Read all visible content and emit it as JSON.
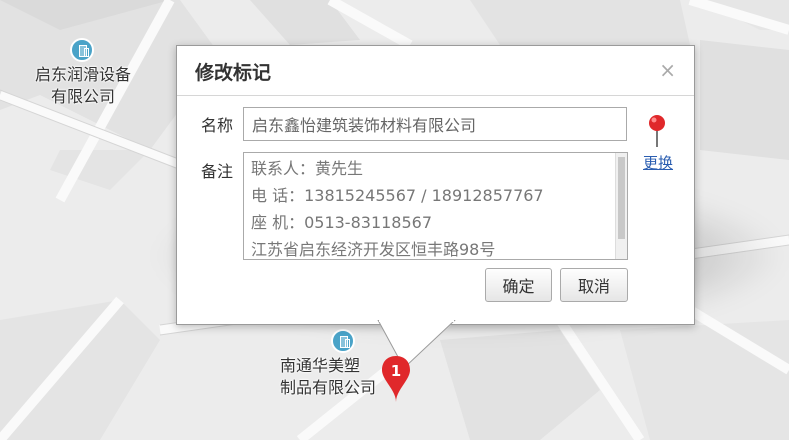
{
  "map": {
    "poi_top": {
      "line1": "启东润滑设备",
      "line2": "有限公司"
    },
    "poi_bottom": {
      "line1": "南通华美塑",
      "line2": "制品有限公司"
    },
    "marker_number": "1"
  },
  "dialog": {
    "title": "修改标记",
    "close_glyph": "×",
    "name_label": "名称",
    "name_value": "启东鑫怡建筑装饰材料有限公司",
    "note_label": "备注",
    "note_lines": [
      "联系人：黄先生",
      "电 话：13815245567 / 18912857767",
      "座 机：0513-83118567",
      "江苏省启东经济开发区恒丰路98号"
    ],
    "change_link": "更换",
    "confirm_label": "确定",
    "cancel_label": "取消",
    "pin_icon": "map-pin-icon",
    "colors": {
      "pin": "#e0282b",
      "marker": "#e0282b",
      "link": "#2a5db0",
      "poi": "#4aa3c8"
    }
  }
}
